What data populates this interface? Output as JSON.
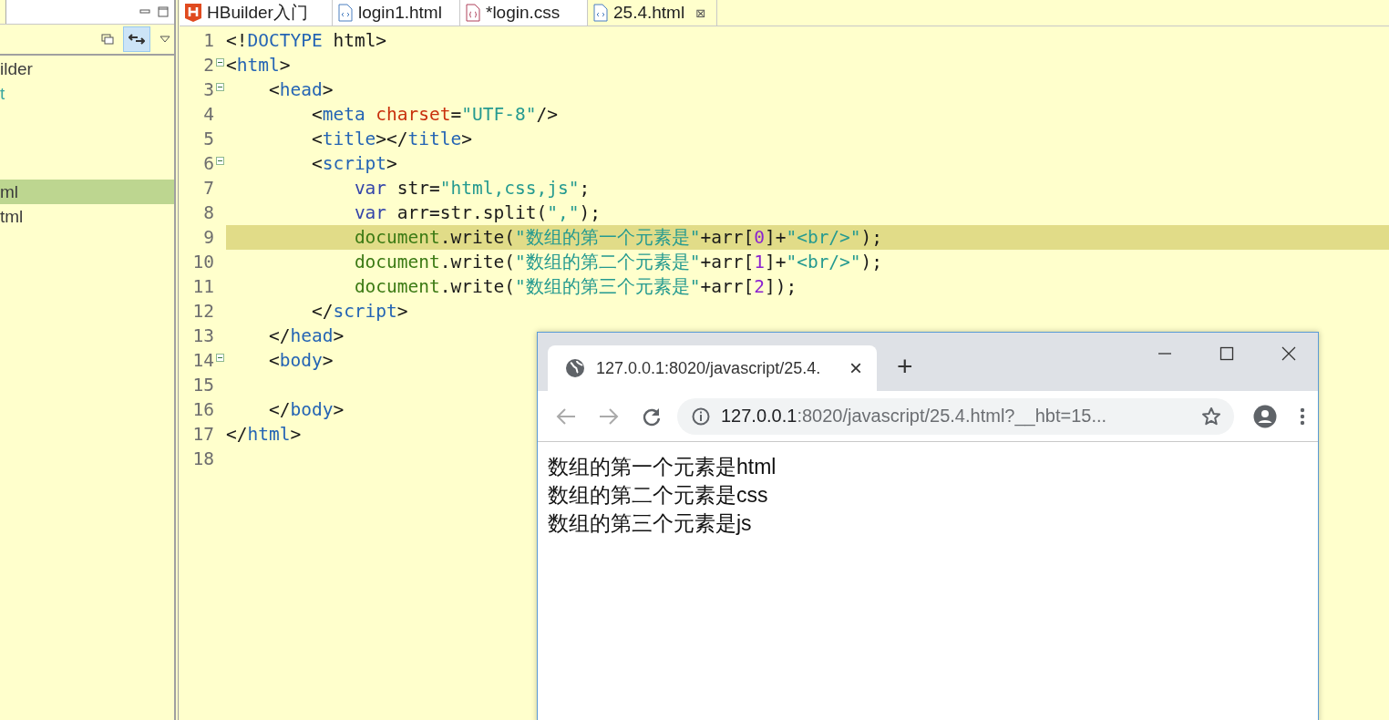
{
  "sidebar": {
    "items": [
      {
        "label": "ilder",
        "selected": false,
        "color": "#3c3c3c"
      },
      {
        "label": "t",
        "selected": false,
        "color": "#3aa6a0"
      },
      {
        "label": "ml",
        "selected": true,
        "color": "#3c3c3c"
      },
      {
        "label": "tml",
        "selected": false,
        "color": "#3c3c3c"
      }
    ]
  },
  "editor_tabs": [
    {
      "label": "HBuilder入门",
      "kind": "hbuilder",
      "selected": false
    },
    {
      "label": "login1.html",
      "kind": "html",
      "selected": false
    },
    {
      "label": "*login.css",
      "kind": "css",
      "selected": false
    },
    {
      "label": "25.4.html",
      "kind": "html",
      "selected": true,
      "close": "⊠"
    }
  ],
  "code_lines": [
    {
      "number": "1",
      "fold": false,
      "highlighted": false,
      "tokens": [
        {
          "kind": "plain",
          "text": "<!"
        },
        {
          "kind": "tag",
          "text": "DOCTYPE"
        },
        {
          "kind": "plain",
          "text": " html>"
        }
      ]
    },
    {
      "number": "2",
      "fold": true,
      "highlighted": false,
      "tokens": [
        {
          "kind": "plain",
          "text": "<"
        },
        {
          "kind": "tag",
          "text": "html"
        },
        {
          "kind": "plain",
          "text": ">"
        }
      ],
      "children": [
        {
          "number": "3",
          "fold": true,
          "highlighted": false,
          "tokens": [
            {
              "kind": "plain",
              "text": "<"
            },
            {
              "kind": "tag",
              "text": "head"
            },
            {
              "kind": "plain",
              "text": ">"
            }
          ],
          "children": [
            {
              "number": "4",
              "fold": false,
              "highlighted": false,
              "tokens": [
                {
                  "kind": "plain",
                  "text": "<"
                },
                {
                  "kind": "tag",
                  "text": "meta"
                },
                {
                  "kind": "attr",
                  "text": " charset"
                },
                {
                  "kind": "plain",
                  "text": "="
                },
                {
                  "kind": "string",
                  "text": "\"UTF-8\""
                },
                {
                  "kind": "plain",
                  "text": "/>"
                }
              ]
            },
            {
              "number": "5",
              "fold": false,
              "highlighted": false,
              "tokens": [
                {
                  "kind": "plain",
                  "text": "<"
                },
                {
                  "kind": "tag",
                  "text": "title"
                },
                {
                  "kind": "plain",
                  "text": "></"
                },
                {
                  "kind": "tag",
                  "text": "title"
                },
                {
                  "kind": "plain",
                  "text": ">"
                }
              ]
            },
            {
              "number": "6",
              "fold": true,
              "highlighted": false,
              "tokens": [
                {
                  "kind": "plain",
                  "text": "<"
                },
                {
                  "kind": "tag",
                  "text": "script"
                },
                {
                  "kind": "plain",
                  "text": ">"
                }
              ],
              "children": [
                {
                  "number": "7",
                  "fold": false,
                  "highlighted": false,
                  "tokens": [
                    {
                      "kind": "keyword",
                      "text": "var"
                    },
                    {
                      "kind": "plain",
                      "text": " str="
                    },
                    {
                      "kind": "string",
                      "text": "\"html,css,js\""
                    },
                    {
                      "kind": "plain",
                      "text": ";"
                    }
                  ]
                },
                {
                  "number": "8",
                  "fold": false,
                  "highlighted": false,
                  "tokens": [
                    {
                      "kind": "keyword",
                      "text": "var"
                    },
                    {
                      "kind": "plain",
                      "text": " arr=str.split("
                    },
                    {
                      "kind": "string",
                      "text": "\",\""
                    },
                    {
                      "kind": "plain",
                      "text": ");"
                    }
                  ]
                },
                {
                  "number": "9",
                  "fold": false,
                  "highlighted": true,
                  "tokens": [
                    {
                      "kind": "object",
                      "text": "document"
                    },
                    {
                      "kind": "plain",
                      "text": ".write("
                    },
                    {
                      "kind": "string",
                      "text": "\"数组的第一个元素是\""
                    },
                    {
                      "kind": "plain",
                      "text": "+arr["
                    },
                    {
                      "kind": "number",
                      "text": "0"
                    },
                    {
                      "kind": "plain",
                      "text": "]+"
                    },
                    {
                      "kind": "string",
                      "text": "\"<br/>\""
                    },
                    {
                      "kind": "plain",
                      "text": ");"
                    }
                  ]
                },
                {
                  "number": "10",
                  "fold": false,
                  "highlighted": false,
                  "tokens": [
                    {
                      "kind": "object",
                      "text": "document"
                    },
                    {
                      "kind": "plain",
                      "text": ".write("
                    },
                    {
                      "kind": "string",
                      "text": "\"数组的第二个元素是\""
                    },
                    {
                      "kind": "plain",
                      "text": "+arr["
                    },
                    {
                      "kind": "number",
                      "text": "1"
                    },
                    {
                      "kind": "plain",
                      "text": "]+"
                    },
                    {
                      "kind": "string",
                      "text": "\"<br/>\""
                    },
                    {
                      "kind": "plain",
                      "text": ");"
                    }
                  ]
                },
                {
                  "number": "11",
                  "fold": false,
                  "highlighted": false,
                  "tokens": [
                    {
                      "kind": "object",
                      "text": "document"
                    },
                    {
                      "kind": "plain",
                      "text": ".write("
                    },
                    {
                      "kind": "string",
                      "text": "\"数组的第三个元素是\""
                    },
                    {
                      "kind": "plain",
                      "text": "+arr["
                    },
                    {
                      "kind": "number",
                      "text": "2"
                    },
                    {
                      "kind": "plain",
                      "text": "]);"
                    }
                  ]
                }
              ]
            },
            {
              "number": "12",
              "fold": false,
              "highlighted": false,
              "tokens": [
                {
                  "kind": "plain",
                  "text": "</"
                },
                {
                  "kind": "tag",
                  "text": "script"
                },
                {
                  "kind": "plain",
                  "text": ">"
                }
              ]
            }
          ]
        },
        {
          "number": "13",
          "fold": false,
          "highlighted": false,
          "tokens": [
            {
              "kind": "plain",
              "text": "</"
            },
            {
              "kind": "tag",
              "text": "head"
            },
            {
              "kind": "plain",
              "text": ">"
            }
          ]
        },
        {
          "number": "14",
          "fold": true,
          "highlighted": false,
          "tokens": [
            {
              "kind": "plain",
              "text": "<"
            },
            {
              "kind": "tag",
              "text": "body"
            },
            {
              "kind": "plain",
              "text": ">"
            }
          ],
          "children": [
            {
              "number": "15",
              "fold": false,
              "highlighted": false
            }
          ]
        },
        {
          "number": "16",
          "fold": false,
          "highlighted": false,
          "tokens": [
            {
              "kind": "plain",
              "text": "</"
            },
            {
              "kind": "tag",
              "text": "body"
            },
            {
              "kind": "plain",
              "text": ">"
            }
          ]
        }
      ]
    },
    {
      "number": "17",
      "fold": false,
      "highlighted": false,
      "tokens": [
        {
          "kind": "plain",
          "text": "</"
        },
        {
          "kind": "tag",
          "text": "html"
        },
        {
          "kind": "plain",
          "text": ">"
        }
      ]
    },
    {
      "number": "18",
      "fold": false,
      "highlighted": false
    }
  ],
  "browser": {
    "tab_title": "127.0.0.1:8020/javascript/25.4.",
    "tab_close": "×",
    "new_tab": "+",
    "url_host": "127.0.0.1",
    "url_rest": ":8020/javascript/25.4.html?__hbt=15...",
    "content_lines": [
      "数组的第一个元素是html",
      "数组的第二个元素是css",
      "数组的第三个元素是js"
    ]
  }
}
